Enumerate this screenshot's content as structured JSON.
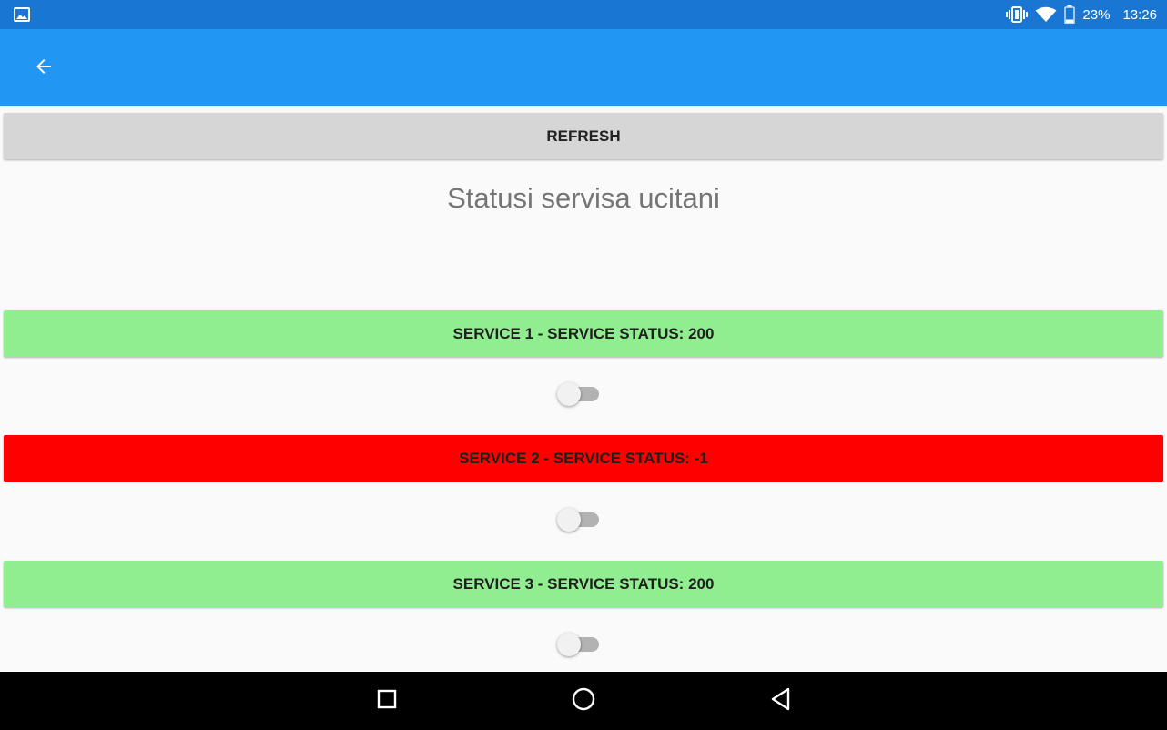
{
  "status_bar": {
    "battery": "23%",
    "time": "13:26",
    "icons": [
      "gallery-icon",
      "vibrate-icon",
      "wifi-icon",
      "battery-icon"
    ]
  },
  "app_bar": {
    "color": "#2196f3",
    "back_icon": "arrow-left-icon"
  },
  "refresh_label": "REFRESH",
  "heading": "Statusi servisa ucitani",
  "services": [
    {
      "label": "SERVICE 1 - SERVICE STATUS: 200",
      "color": "#90ee90",
      "toggle_on": false
    },
    {
      "label": "SERVICE 2 - SERVICE STATUS: -1",
      "color": "#ff0000",
      "toggle_on": false
    },
    {
      "label": "SERVICE 3 - SERVICE STATUS: 200",
      "color": "#90ee90",
      "toggle_on": false
    }
  ],
  "nav_bar": {
    "icons": [
      "recents-square-icon",
      "home-circle-icon",
      "back-triangle-icon"
    ]
  }
}
